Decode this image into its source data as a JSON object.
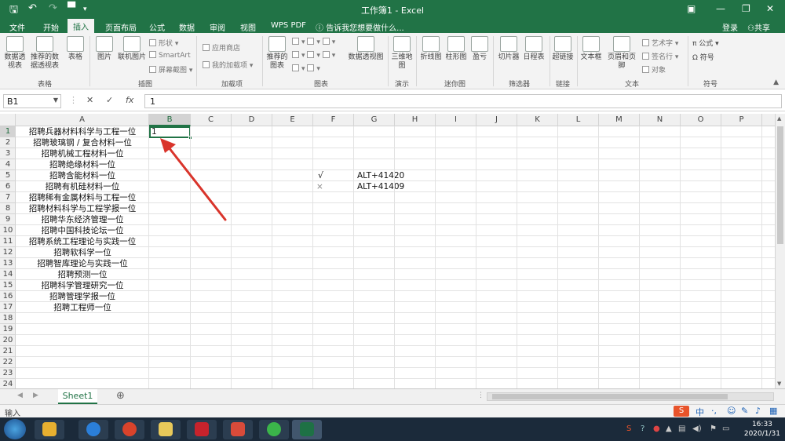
{
  "window": {
    "title": "工作簿1 - Excel",
    "login": "登录",
    "share": "共享"
  },
  "tabs": [
    "文件",
    "开始",
    "插入",
    "页面布局",
    "公式",
    "数据",
    "审阅",
    "视图",
    "WPS PDF"
  ],
  "tell_me": "告诉我您想要做什么...",
  "ribbon": {
    "table_group": {
      "label": "表格",
      "pivot": "数据透视表",
      "recommended_pivot": "推荐的数据透视表",
      "table": "表格"
    },
    "illustrations": {
      "label": "插图",
      "pictures": "图片",
      "online_pictures": "联机图片",
      "shapes": "形状",
      "smartart": "SmartArt",
      "screenshot": "屏幕截图"
    },
    "addins": {
      "label": "加载项",
      "store": "应用商店",
      "my_addins": "我的加载项"
    },
    "charts": {
      "label": "图表",
      "recommended": "推荐的图表",
      "pivot_chart": "数据透视图"
    },
    "tours": {
      "label": "演示",
      "map3d": "三维地图"
    },
    "sparklines": {
      "label": "迷你图",
      "line": "折线图",
      "column": "柱形图",
      "winloss": "盈亏"
    },
    "filters": {
      "label": "筛选器",
      "slicer": "切片器",
      "timeline": "日程表"
    },
    "links": {
      "label": "链接",
      "hyperlink": "超链接"
    },
    "text": {
      "label": "文本",
      "textbox": "文本框",
      "header_footer": "页眉和页脚",
      "wordart": "艺术字",
      "signature": "签名行",
      "object": "对象"
    },
    "symbols": {
      "label": "符号",
      "equation": "公式",
      "symbol": "符号"
    }
  },
  "formula_bar": {
    "name_box": "B1",
    "cancel": "✕",
    "enter": "✓",
    "fx": "fx",
    "value": "1"
  },
  "columns": [
    "A",
    "B",
    "C",
    "D",
    "E",
    "F",
    "G",
    "H",
    "I",
    "J",
    "K",
    "L",
    "M",
    "N",
    "O",
    "P"
  ],
  "rows": [
    "1",
    "2",
    "3",
    "4",
    "5",
    "6",
    "7",
    "8",
    "9",
    "10",
    "11",
    "12",
    "13",
    "14",
    "15",
    "16",
    "17",
    "18",
    "19",
    "20",
    "21",
    "22",
    "23",
    "24"
  ],
  "column_a": [
    "招聘兵器材料科学与工程一位",
    "招聘玻璃钢 / 复合材料一位",
    "招聘机械工程材料一位",
    "招聘绝缘材料一位",
    "招聘含能材料一位",
    "招聘有机硅材料一位",
    "招聘稀有金属材料与工程一位",
    "招聘材料科学与工程学报一位",
    "招聘华东经济管理一位",
    "招聘中国科技论坛一位",
    "招聘系统工程理论与实践一位",
    "招聘软科学一位",
    "招聘智库理论与实践一位",
    "招聘预测一位",
    "招聘科学管理研究一位",
    "招聘管理学报一位",
    "招聘工程师一位"
  ],
  "cell_b1": "1",
  "symbols_table": [
    {
      "symbol": "√",
      "code": "ALT+41420"
    },
    {
      "symbol": "×",
      "code": "ALT+41409"
    }
  ],
  "sheet_tab": "Sheet1",
  "status_mode": "输入",
  "clock": {
    "time": "16:33",
    "date": "2020/1/31"
  },
  "ime": "中",
  "colors": {
    "excel_green": "#217346",
    "arrow": "#d9342b"
  }
}
